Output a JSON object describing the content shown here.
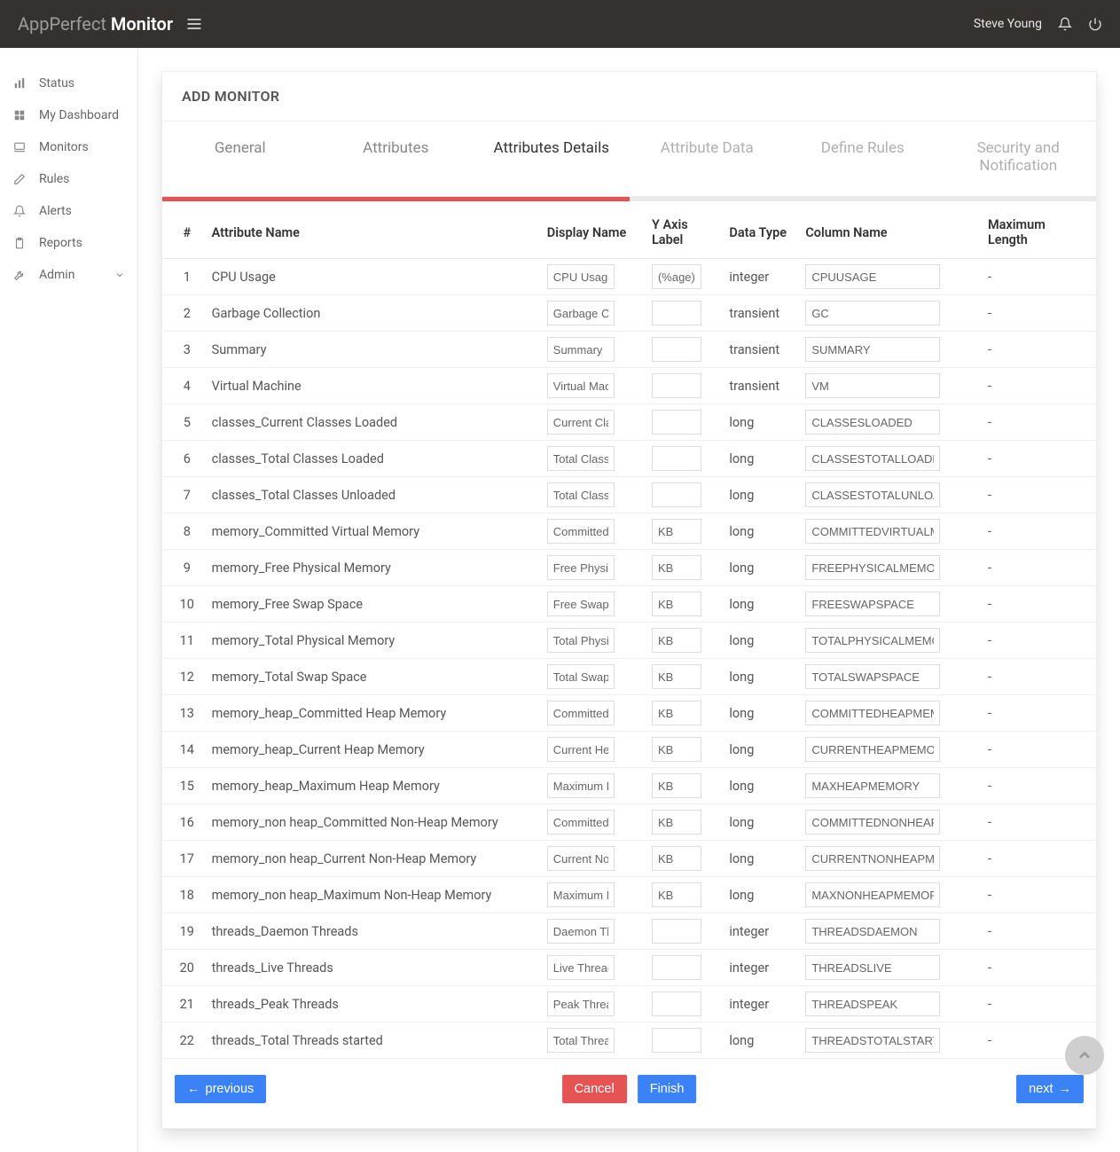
{
  "header": {
    "brand_light": "AppPerfect",
    "brand_bold": "Monitor",
    "user_name": "Steve Young"
  },
  "sidebar": {
    "items": [
      {
        "label": "Status",
        "icon": "bar-chart-icon"
      },
      {
        "label": "My Dashboard",
        "icon": "grid-icon"
      },
      {
        "label": "Monitors",
        "icon": "laptop-icon"
      },
      {
        "label": "Rules",
        "icon": "pencil-icon"
      },
      {
        "label": "Alerts",
        "icon": "bell-icon"
      },
      {
        "label": "Reports",
        "icon": "clipboard-icon"
      },
      {
        "label": "Admin",
        "icon": "wrench-icon",
        "expandable": true
      }
    ]
  },
  "page": {
    "title": "ADD MONITOR",
    "tabs": [
      {
        "label": "General",
        "state": "done"
      },
      {
        "label": "Attributes",
        "state": "done"
      },
      {
        "label": "Attributes Details",
        "state": "active"
      },
      {
        "label": "Attribute Data",
        "state": "todo"
      },
      {
        "label": "Define Rules",
        "state": "todo"
      },
      {
        "label": "Security and Notification",
        "state": "todo"
      }
    ],
    "progress_percent": 50,
    "columns": {
      "num": "#",
      "attr": "Attribute Name",
      "disp": "Display Name",
      "yaxis": "Y Axis Label",
      "dtype": "Data Type",
      "colname": "Column Name",
      "maxlen": "Maximum Length"
    },
    "rows": [
      {
        "n": "1",
        "attr": "CPU Usage",
        "disp": "CPU Usage",
        "yaxis": "(%age)",
        "dtype": "integer",
        "col": "CPUUSAGE",
        "maxlen": "-"
      },
      {
        "n": "2",
        "attr": "Garbage Collection",
        "disp": "Garbage Collection",
        "yaxis": "",
        "dtype": "transient",
        "col": "GC",
        "maxlen": "-"
      },
      {
        "n": "3",
        "attr": "Summary",
        "disp": "Summary",
        "yaxis": "",
        "dtype": "transient",
        "col": "SUMMARY",
        "maxlen": "-"
      },
      {
        "n": "4",
        "attr": "Virtual Machine",
        "disp": "Virtual Machine",
        "yaxis": "",
        "dtype": "transient",
        "col": "VM",
        "maxlen": "-"
      },
      {
        "n": "5",
        "attr": "classes_Current Classes Loaded",
        "disp": "Current Classes Loaded",
        "yaxis": "",
        "dtype": "long",
        "col": "CLASSESLOADED",
        "maxlen": "-"
      },
      {
        "n": "6",
        "attr": "classes_Total Classes Loaded",
        "disp": "Total Classes Loaded",
        "yaxis": "",
        "dtype": "long",
        "col": "CLASSESTOTALLOADED",
        "maxlen": "-"
      },
      {
        "n": "7",
        "attr": "classes_Total Classes Unloaded",
        "disp": "Total Classes Unloaded",
        "yaxis": "",
        "dtype": "long",
        "col": "CLASSESTOTALUNLOADED",
        "maxlen": "-"
      },
      {
        "n": "8",
        "attr": "memory_Committed Virtual Memory",
        "disp": "Committed Virtual Memory",
        "yaxis": "KB",
        "dtype": "long",
        "col": "COMMITTEDVIRTUALMEMORY",
        "maxlen": "-"
      },
      {
        "n": "9",
        "attr": "memory_Free Physical Memory",
        "disp": "Free Physical Memory",
        "yaxis": "KB",
        "dtype": "long",
        "col": "FREEPHYSICALMEMORY",
        "maxlen": "-"
      },
      {
        "n": "10",
        "attr": "memory_Free Swap Space",
        "disp": "Free Swap Space",
        "yaxis": "KB",
        "dtype": "long",
        "col": "FREESWAPSPACE",
        "maxlen": "-"
      },
      {
        "n": "11",
        "attr": "memory_Total Physical Memory",
        "disp": "Total Physical Memory",
        "yaxis": "KB",
        "dtype": "long",
        "col": "TOTALPHYSICALMEMORY",
        "maxlen": "-"
      },
      {
        "n": "12",
        "attr": "memory_Total Swap Space",
        "disp": "Total Swap Space",
        "yaxis": "KB",
        "dtype": "long",
        "col": "TOTALSWAPSPACE",
        "maxlen": "-"
      },
      {
        "n": "13",
        "attr": "memory_heap_Committed Heap Memory",
        "disp": "Committed Heap Memory",
        "yaxis": "KB",
        "dtype": "long",
        "col": "COMMITTEDHEAPMEMORY",
        "maxlen": "-"
      },
      {
        "n": "14",
        "attr": "memory_heap_Current Heap Memory",
        "disp": "Current Heap Memory",
        "yaxis": "KB",
        "dtype": "long",
        "col": "CURRENTHEAPMEMORY",
        "maxlen": "-"
      },
      {
        "n": "15",
        "attr": "memory_heap_Maximum Heap Memory",
        "disp": "Maximum Heap Memory",
        "yaxis": "KB",
        "dtype": "long",
        "col": "MAXHEAPMEMORY",
        "maxlen": "-"
      },
      {
        "n": "16",
        "attr": "memory_non heap_Committed Non-Heap Memory",
        "disp": "Committed Non-Heap Memory",
        "yaxis": "KB",
        "dtype": "long",
        "col": "COMMITTEDNONHEAPMEMORY",
        "maxlen": "-"
      },
      {
        "n": "17",
        "attr": "memory_non heap_Current Non-Heap Memory",
        "disp": "Current Non-Heap Memory",
        "yaxis": "KB",
        "dtype": "long",
        "col": "CURRENTNONHEAPMEMORY",
        "maxlen": "-"
      },
      {
        "n": "18",
        "attr": "memory_non heap_Maximum Non-Heap Memory",
        "disp": "Maximum Non-Heap Memory",
        "yaxis": "KB",
        "dtype": "long",
        "col": "MAXNONHEAPMEMORY",
        "maxlen": "-"
      },
      {
        "n": "19",
        "attr": "threads_Daemon Threads",
        "disp": "Daemon Threads",
        "yaxis": "",
        "dtype": "integer",
        "col": "THREADSDAEMON",
        "maxlen": "-"
      },
      {
        "n": "20",
        "attr": "threads_Live Threads",
        "disp": "Live Threads",
        "yaxis": "",
        "dtype": "integer",
        "col": "THREADSLIVE",
        "maxlen": "-"
      },
      {
        "n": "21",
        "attr": "threads_Peak Threads",
        "disp": "Peak Threads",
        "yaxis": "",
        "dtype": "integer",
        "col": "THREADSPEAK",
        "maxlen": "-"
      },
      {
        "n": "22",
        "attr": "threads_Total Threads started",
        "disp": "Total Threads started",
        "yaxis": "",
        "dtype": "long",
        "col": "THREADSTOTALSTARTED",
        "maxlen": "-"
      }
    ],
    "buttons": {
      "previous": "previous",
      "cancel": "Cancel",
      "finish": "Finish",
      "next": "next"
    }
  }
}
